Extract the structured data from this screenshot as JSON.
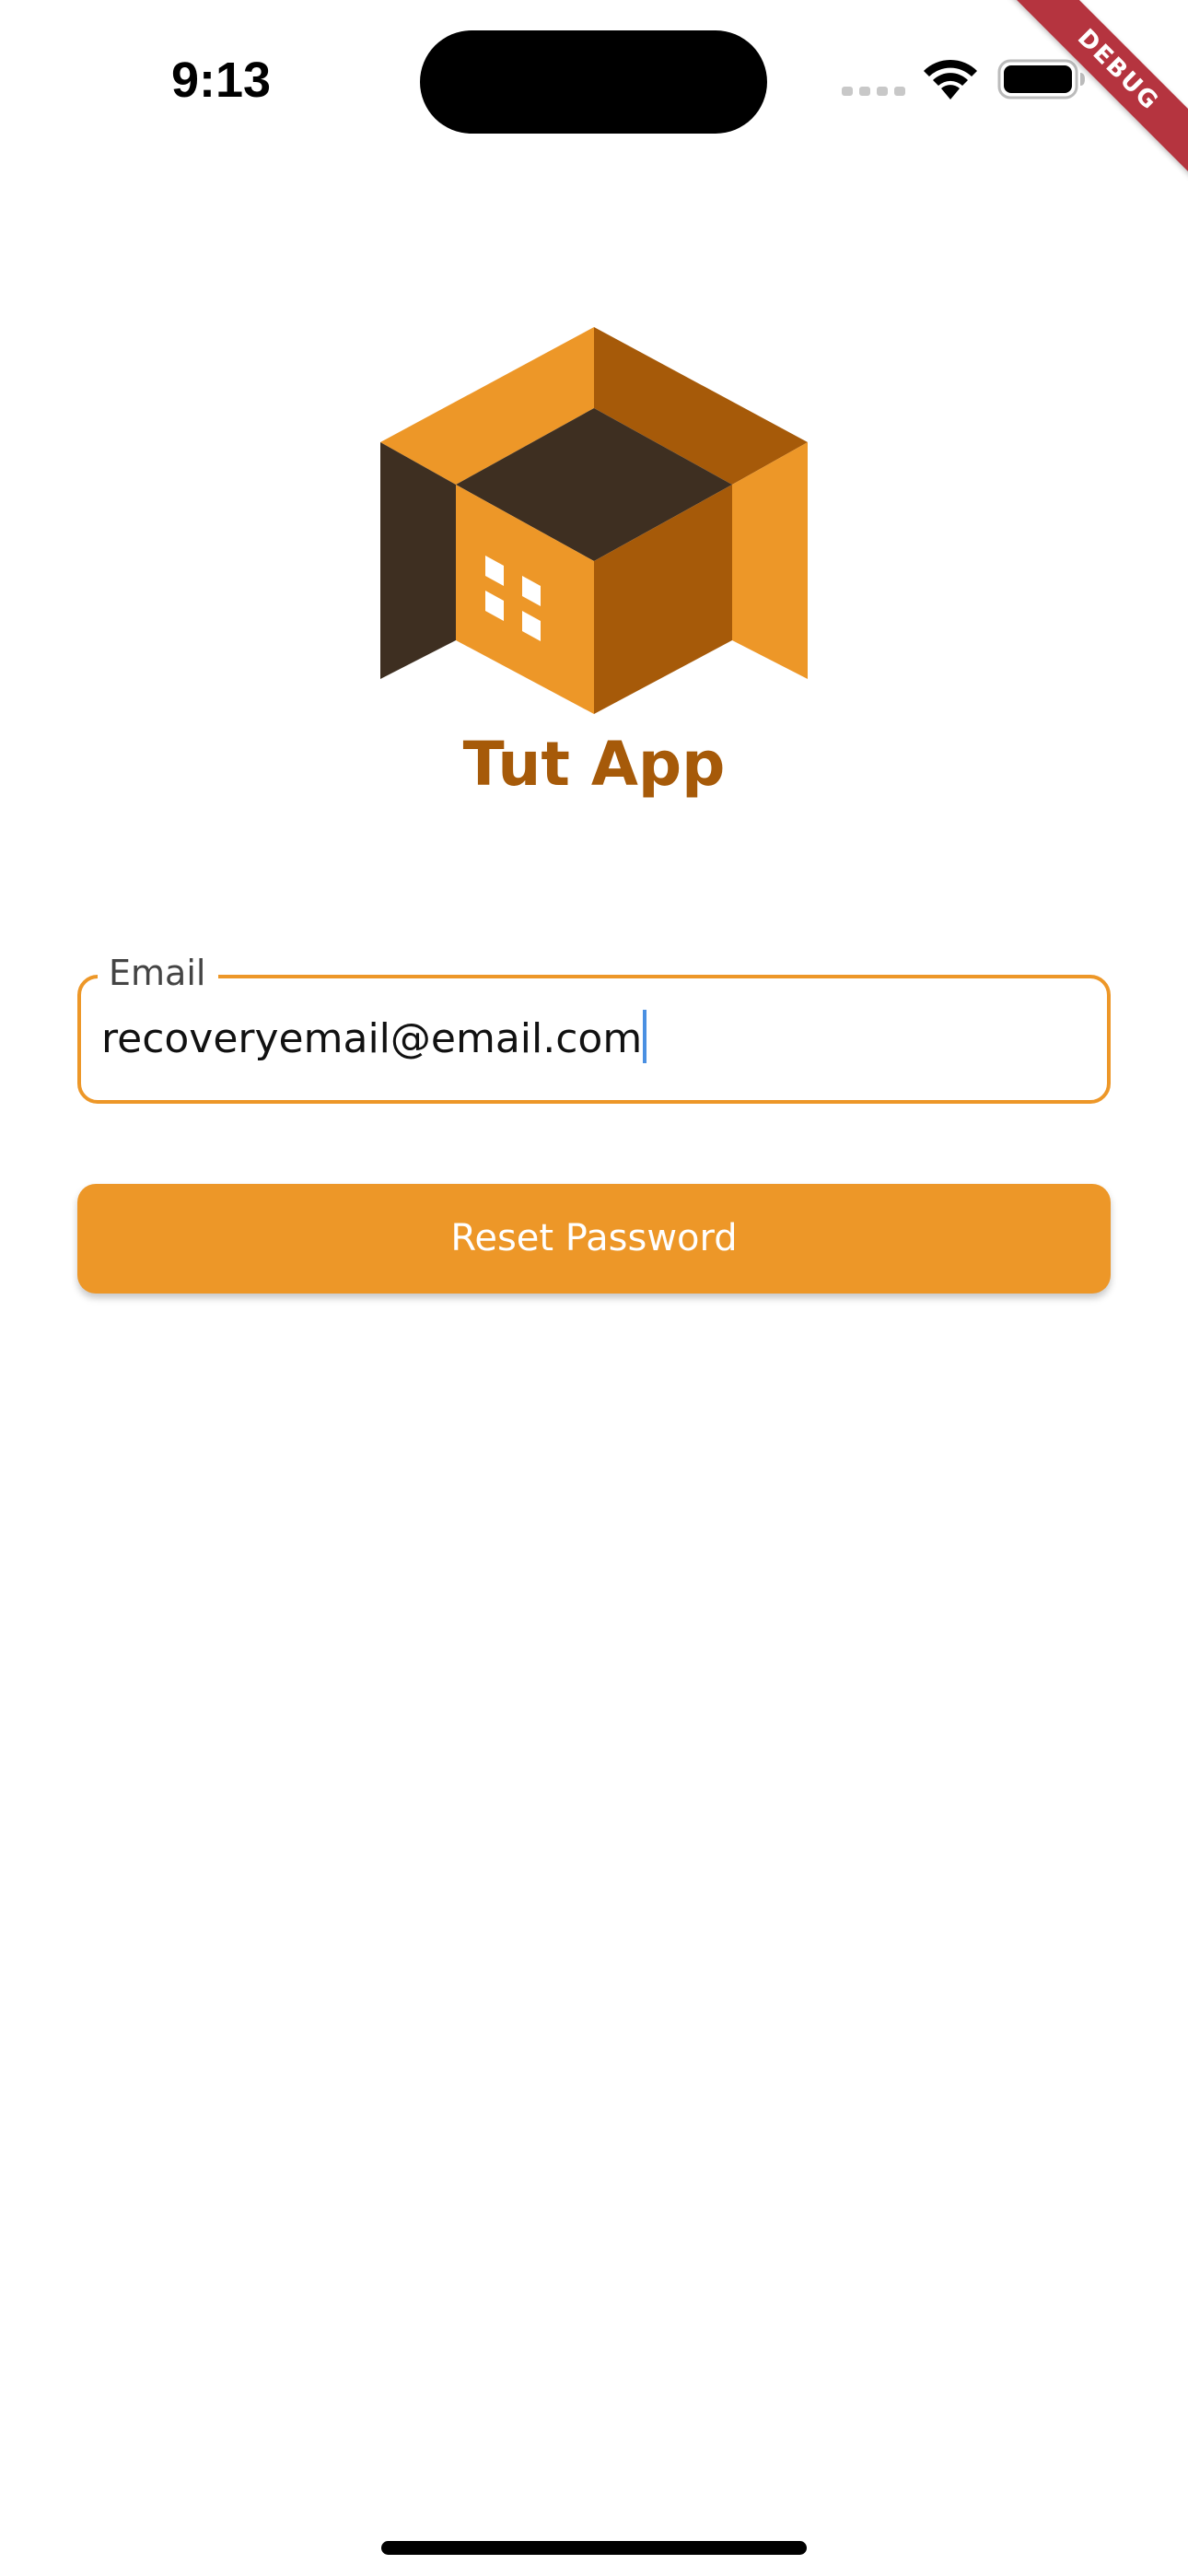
{
  "status_bar": {
    "time": "9:13",
    "signal_icon": "cellular-signal-icon",
    "wifi_icon": "wifi-icon",
    "battery_icon": "battery-icon"
  },
  "debug_banner": "DEBUG",
  "logo": {
    "icon": "house-cube-logo-icon",
    "app_name": "Tut App"
  },
  "email_field": {
    "label": "Email",
    "value": "recoveryemail@email.com"
  },
  "reset_button": {
    "label": "Reset Password"
  },
  "colors": {
    "primary": "#ED9728",
    "primary_dark": "#A65A09",
    "logo_dark": "#3E2F21",
    "debug_ribbon": "#B5343F",
    "caret": "#4A90E2"
  }
}
